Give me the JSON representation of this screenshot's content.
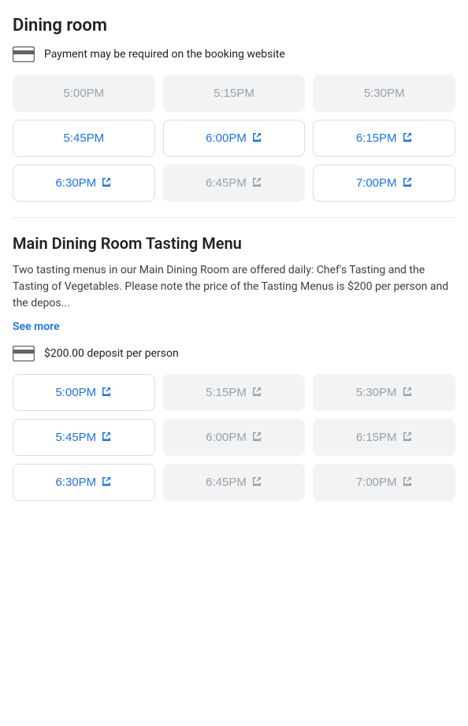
{
  "section1": {
    "title": "Dining room",
    "payment_notice": "Payment may be required on the booking website",
    "time_slots": [
      {
        "time": "5:00PM",
        "state": "disabled",
        "external": false
      },
      {
        "time": "5:15PM",
        "state": "disabled",
        "external": false
      },
      {
        "time": "5:30PM",
        "state": "disabled",
        "external": false
      },
      {
        "time": "5:45PM",
        "state": "available",
        "external": false
      },
      {
        "time": "6:00PM",
        "state": "available",
        "external": true
      },
      {
        "time": "6:15PM",
        "state": "available",
        "external": true
      },
      {
        "time": "6:30PM",
        "state": "available",
        "external": true
      },
      {
        "time": "6:45PM",
        "state": "disabled",
        "external": true
      },
      {
        "time": "7:00PM",
        "state": "available",
        "external": true
      }
    ]
  },
  "section2": {
    "title": "Main Dining Room Tasting Menu",
    "description": "Two tasting menus in our Main Dining Room are offered daily: Chef's Tasting and the Tasting of Vegetables. Please note the price of the Tasting Menus is $200 per person and the depos...",
    "see_more_label": "See more",
    "deposit_notice": "$200.00 deposit per person",
    "time_slots": [
      {
        "time": "5:00PM",
        "state": "available",
        "external": true
      },
      {
        "time": "5:15PM",
        "state": "disabled",
        "external": true
      },
      {
        "time": "5:30PM",
        "state": "disabled",
        "external": true
      },
      {
        "time": "5:45PM",
        "state": "available",
        "external": true
      },
      {
        "time": "6:00PM",
        "state": "disabled",
        "external": true
      },
      {
        "time": "6:15PM",
        "state": "disabled",
        "external": true
      },
      {
        "time": "6:30PM",
        "state": "available",
        "external": true
      },
      {
        "time": "6:45PM",
        "state": "disabled",
        "external": true
      },
      {
        "time": "7:00PM",
        "state": "disabled",
        "external": true
      }
    ]
  },
  "icons": {
    "external_link": "⊙",
    "card_icon": "card"
  }
}
